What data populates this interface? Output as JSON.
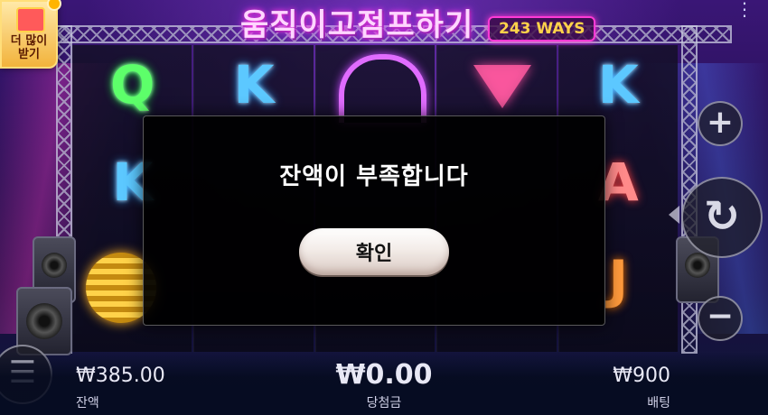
{
  "game": {
    "title": "움직이고점프하기",
    "ways_badge": "243 WAYS"
  },
  "promo": {
    "label_line1": "더 많이",
    "label_line2": "받기"
  },
  "reels": {
    "symbols": [
      "Q",
      "K",
      "K",
      "A",
      "K",
      "J"
    ],
    "icons": [
      "headphones-icon",
      "cocktail-icon",
      "disco-ball-icon",
      "speaker-icon"
    ]
  },
  "controls": {
    "plus": "+",
    "minus": "−",
    "spin": "↻",
    "menu": "☰",
    "more": "⋮"
  },
  "footer": {
    "balance_amount": "₩385.00",
    "balance_label": "잔액",
    "win_amount": "₩0.00",
    "win_label": "당첨금",
    "bet_amount": "₩900",
    "bet_label": "배팅"
  },
  "dialog": {
    "message": "잔액이 부족합니다",
    "confirm_label": "확인"
  },
  "colors": {
    "dialog_bg": "#000000",
    "neon_green": "#5dff6a",
    "neon_blue": "#5cc8ff",
    "neon_pink": "#ff3ad6",
    "gold": "#ffd24a"
  }
}
